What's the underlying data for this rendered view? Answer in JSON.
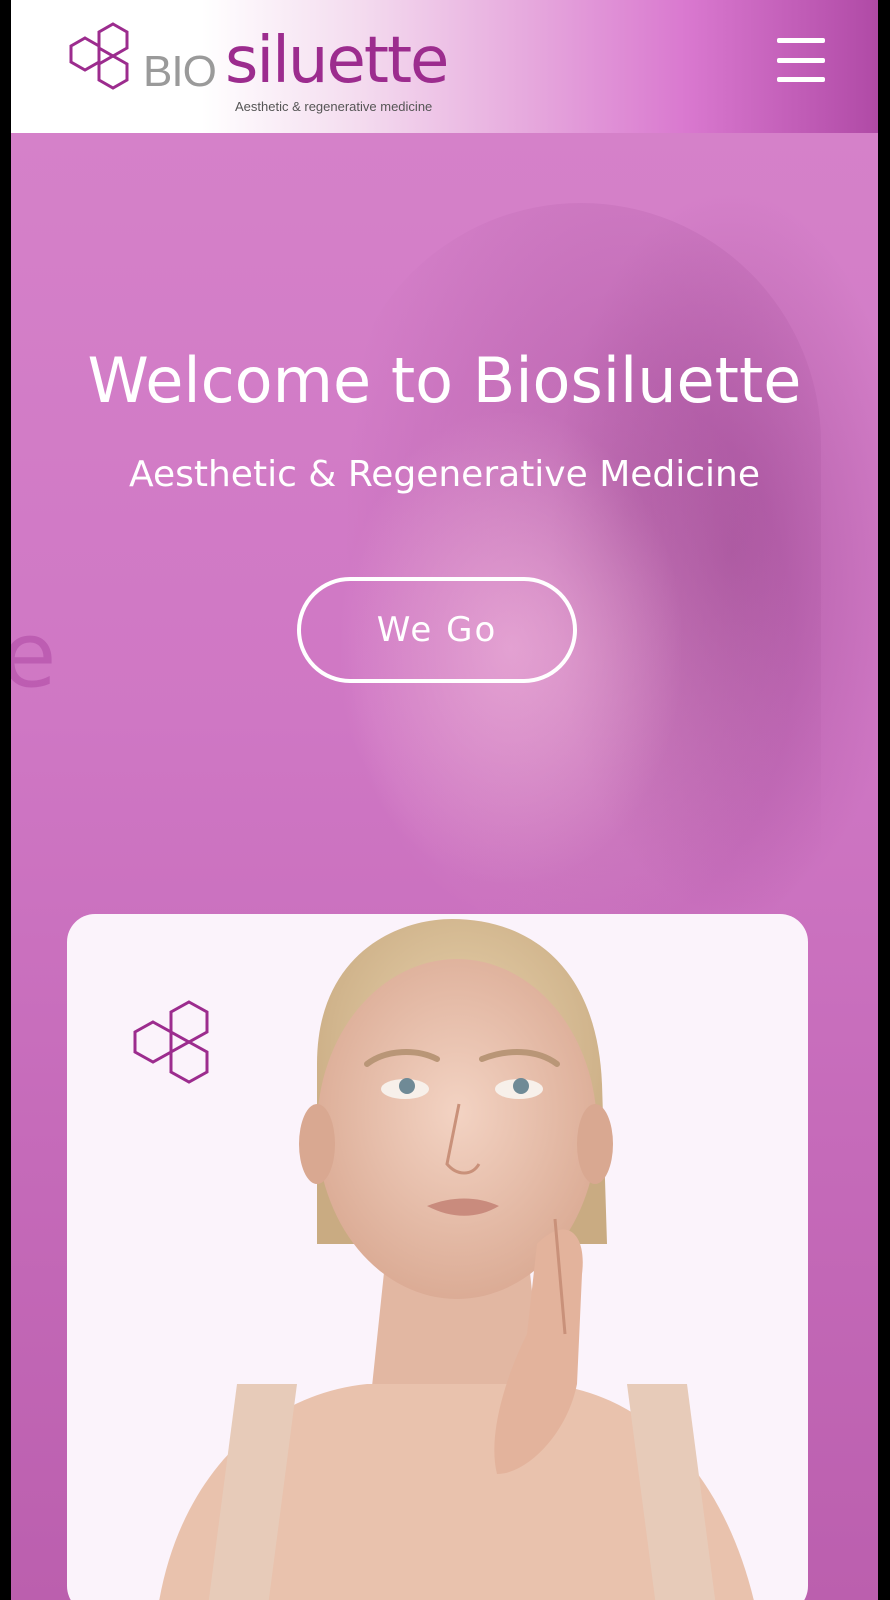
{
  "header": {
    "logo": {
      "prefix": "BIO",
      "name": "siluette",
      "tagline": "Aesthetic & regenerative medicine"
    },
    "menu_icon": "hamburger-menu-icon"
  },
  "hero": {
    "title": "Welcome to Biosiluette",
    "subtitle": "Aesthetic & Regenerative Medicine",
    "cta_label": "We Go"
  },
  "colors": {
    "brand_purple": "#9c2c8e",
    "hero_pink": "#cf77c4",
    "white": "#ffffff",
    "card_bg": "#fbf3fb"
  },
  "card": {
    "icon": "hexagon-cluster-icon"
  }
}
